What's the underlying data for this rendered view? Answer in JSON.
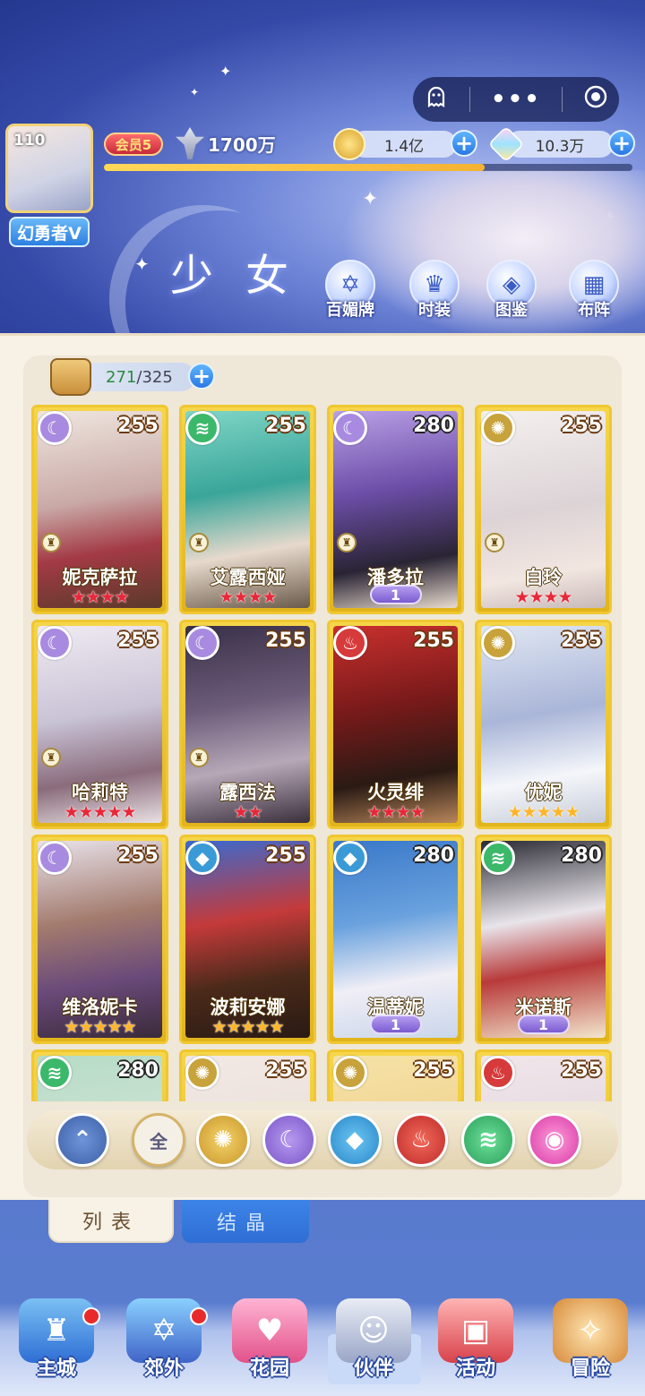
{
  "header": {
    "capsule": {
      "menu_icon": "ghost-icon",
      "more_label": "•••",
      "record_icon": "target-icon"
    },
    "player": {
      "level": "110",
      "title": "幻勇者V",
      "vip": "会员5",
      "power": "1700万",
      "exp_progress": 0.72
    },
    "currencies": [
      {
        "name": "gold",
        "value": "1.4亿",
        "icon": "gold-coin-icon"
      },
      {
        "name": "crystal",
        "value": "10.3万",
        "icon": "crystal-icon"
      }
    ],
    "section_title": "少女",
    "buttons": [
      {
        "label": "百媚牌",
        "icon": "cards-icon"
      },
      {
        "label": "时装",
        "icon": "outfit-icon"
      },
      {
        "label": "图鉴",
        "icon": "book-icon"
      },
      {
        "label": "布阵",
        "icon": "formation-icon"
      }
    ]
  },
  "roster": {
    "owned": "271",
    "capacity": "325",
    "separator": "/",
    "cards": [
      {
        "name": "妮克萨拉",
        "level": "255",
        "element": "moon",
        "stars": 4,
        "star_color": "red",
        "role": true,
        "awaken": ""
      },
      {
        "name": "艾露西娅",
        "level": "255",
        "element": "wind",
        "stars": 4,
        "star_color": "red",
        "role": true,
        "awaken": ""
      },
      {
        "name": "潘多拉",
        "level": "280",
        "element": "moon",
        "stars": 0,
        "star_color": "red",
        "role": true,
        "awaken": "1"
      },
      {
        "name": "白玲",
        "level": "255",
        "element": "sun",
        "stars": 4,
        "star_color": "red",
        "role": true,
        "awaken": ""
      },
      {
        "name": "哈莉特",
        "level": "255",
        "element": "moon",
        "stars": 5,
        "star_color": "red",
        "role": true,
        "awaken": ""
      },
      {
        "name": "露西法",
        "level": "255",
        "element": "moon",
        "stars": 2,
        "star_color": "red",
        "role": true,
        "awaken": ""
      },
      {
        "name": "火灵绯",
        "level": "255",
        "element": "fire",
        "stars": 4,
        "star_color": "red",
        "role": false,
        "awaken": ""
      },
      {
        "name": "优妮",
        "level": "255",
        "element": "sun",
        "stars": 5,
        "star_color": "gold",
        "role": false,
        "awaken": ""
      },
      {
        "name": "维洛妮卡",
        "level": "255",
        "element": "moon",
        "stars": 5,
        "star_color": "gold",
        "role": false,
        "awaken": ""
      },
      {
        "name": "波莉安娜",
        "level": "255",
        "element": "water",
        "stars": 5,
        "star_color": "gold",
        "role": false,
        "awaken": ""
      },
      {
        "name": "温蒂妮",
        "level": "280",
        "element": "water",
        "stars": 0,
        "star_color": "gold",
        "role": false,
        "awaken": "1"
      },
      {
        "name": "米诺斯",
        "level": "280",
        "element": "wind",
        "stars": 0,
        "star_color": "gold",
        "role": false,
        "awaken": "1"
      },
      {
        "name": "",
        "level": "280",
        "element": "wind",
        "stars": 0,
        "star_color": "gold",
        "role": false,
        "awaken": ""
      },
      {
        "name": "",
        "level": "255",
        "element": "sun",
        "stars": 0,
        "star_color": "gold",
        "role": false,
        "awaken": ""
      },
      {
        "name": "",
        "level": "255",
        "element": "sun",
        "stars": 0,
        "star_color": "gold",
        "role": false,
        "awaken": ""
      },
      {
        "name": "",
        "level": "255",
        "element": "fire",
        "stars": 0,
        "star_color": "gold",
        "role": false,
        "awaken": ""
      }
    ]
  },
  "filters": [
    {
      "id": "collapse",
      "label": "",
      "icon": "chevron-up-icon"
    },
    {
      "id": "all",
      "label": "全",
      "icon": ""
    },
    {
      "id": "sun",
      "label": "",
      "icon": "sun-element-icon"
    },
    {
      "id": "moon",
      "label": "",
      "icon": "moon-element-icon"
    },
    {
      "id": "water",
      "label": "",
      "icon": "water-element-icon"
    },
    {
      "id": "fire",
      "label": "",
      "icon": "fire-element-icon"
    },
    {
      "id": "wind",
      "label": "",
      "icon": "wind-element-icon"
    },
    {
      "id": "pink",
      "label": "",
      "icon": "orb-element-icon"
    }
  ],
  "tabs": [
    {
      "label": "列表",
      "active": true
    },
    {
      "label": "结晶",
      "active": false
    }
  ],
  "nav": [
    {
      "label": "主城",
      "icon": "castle-icon",
      "badge": true
    },
    {
      "label": "郊外",
      "icon": "portal-icon",
      "badge": true
    },
    {
      "label": "花园",
      "icon": "heart-icon",
      "badge": false
    },
    {
      "label": "伙伴",
      "icon": "partner-icon",
      "badge": false,
      "active": true
    },
    {
      "label": "活动",
      "icon": "gift-icon",
      "badge": false
    },
    {
      "label": "冒险",
      "icon": "compass-icon",
      "badge": false
    }
  ],
  "colors": {
    "card_gold": "#f0c731",
    "accent_blue": "#2f6ed4",
    "panel_bg": "#f7f1e6"
  }
}
